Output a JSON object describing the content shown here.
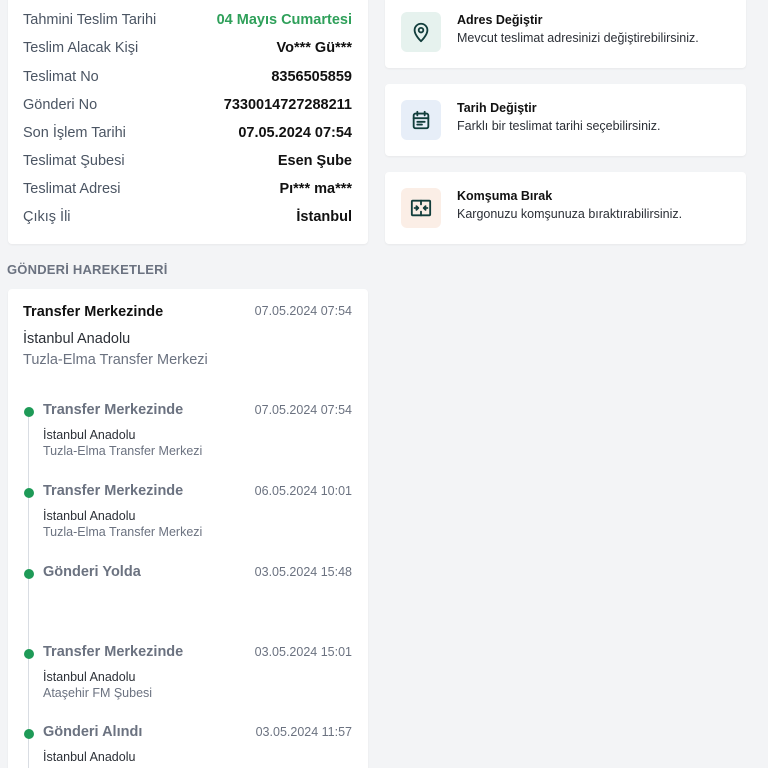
{
  "shipment_info": {
    "rows": [
      {
        "label": "Tahmini Teslim Tarihi",
        "value": "04 Mayıs Cumartesi"
      },
      {
        "label": "Teslim Alacak Kişi",
        "value": "Vo*** Gü***"
      },
      {
        "label": "Teslimat No",
        "value": "8356505859"
      },
      {
        "label": "Gönderi No",
        "value": "7330014727288211"
      },
      {
        "label": "Son İşlem Tarihi",
        "value": "07.05.2024 07:54"
      },
      {
        "label": "Teslimat Şubesi",
        "value": "Esen Şube"
      },
      {
        "label": "Teslimat Adresi",
        "value": "Pı*** ma***"
      },
      {
        "label": "Çıkış İli",
        "value": "İstanbul"
      }
    ],
    "highlight_color": "#2fa05a"
  },
  "movements": {
    "section_title": "GÖNDERİ HAREKETLERİ",
    "latest": {
      "title": "Transfer Merkezinde",
      "date": "07.05.2024 07:54",
      "city": "İstanbul Anadolu",
      "branch": "Tuzla-Elma Transfer Merkezi"
    },
    "timeline": [
      {
        "title": "Transfer Merkezinde",
        "date": "07.05.2024 07:54",
        "city": "İstanbul Anadolu",
        "branch": "Tuzla-Elma Transfer Merkezi"
      },
      {
        "title": "Transfer Merkezinde",
        "date": "06.05.2024 10:01",
        "city": "İstanbul Anadolu",
        "branch": "Tuzla-Elma Transfer Merkezi"
      },
      {
        "title": "Gönderi Yolda",
        "date": "03.05.2024 15:48",
        "city": "",
        "branch": ""
      },
      {
        "title": "Transfer Merkezinde",
        "date": "03.05.2024 15:01",
        "city": "İstanbul Anadolu",
        "branch": "Ataşehir FM Şubesi"
      },
      {
        "title": "Gönderi Alındı",
        "date": "03.05.2024 11:57",
        "city": "İstanbul Anadolu",
        "branch": ""
      }
    ],
    "dot_color": "#1e9a57"
  },
  "actions": [
    {
      "title": "Adres Değiştir",
      "description": "Mevcut teslimat adresinizi değiştirebilirsiniz.",
      "icon": "location-pin-icon",
      "icon_bg": "#e6f2ee"
    },
    {
      "title": "Tarih Değiştir",
      "description": "Farklı bir teslimat tarihi seçebilirsiniz.",
      "icon": "calendar-icon",
      "icon_bg": "#e7eef8"
    },
    {
      "title": "Komşuma Bırak",
      "description": "Kargonuzu komşunuza bıraktırabilirsiniz.",
      "icon": "neighbor-transfer-icon",
      "icon_bg": "#fbeee6"
    }
  ]
}
